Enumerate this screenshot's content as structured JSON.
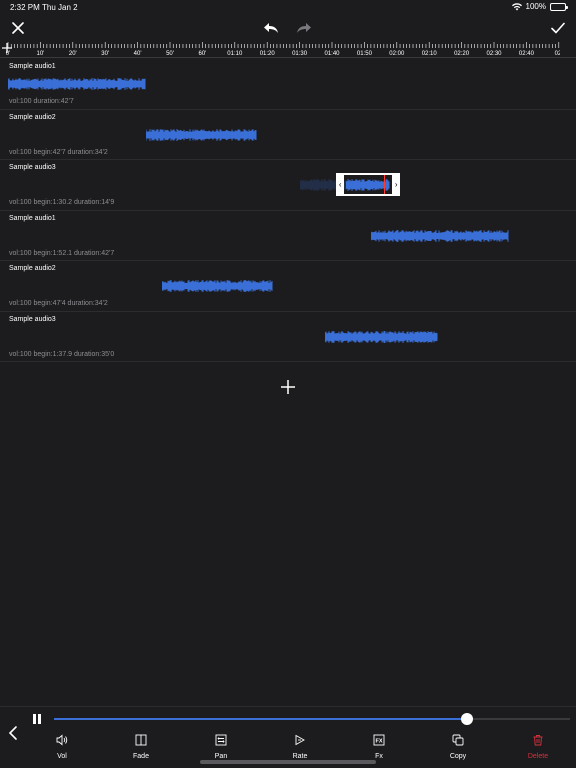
{
  "status": {
    "time": "2:32 PM",
    "date": "Thu Jan 2",
    "battery": "100%"
  },
  "ruler": {
    "labels": [
      "0'",
      "10'",
      "20'",
      "30'",
      "40'",
      "50'",
      "60'",
      "01:10",
      "01:20",
      "01:30",
      "01:40",
      "01:50",
      "02:00",
      "02:10",
      "02:20",
      "02:30",
      "02:40",
      "02:"
    ]
  },
  "tracks": [
    {
      "name": "Sample audio1",
      "info": "vol:100 duration:42'7",
      "start": 0,
      "duration": 42.7
    },
    {
      "name": "Sample audio2",
      "info": "vol:100 begin:42'7 duration:34'2",
      "start": 42.7,
      "duration": 34.2
    },
    {
      "name": "Sample audio3",
      "info": "vol:100 begin:1:30.2 duration:14'9",
      "start": 90.2,
      "duration": 14.9,
      "selected": true
    },
    {
      "name": "Sample audio1",
      "info": "vol:100 begin:1:52.1 duration:42'7",
      "start": 112.1,
      "duration": 42.7
    },
    {
      "name": "Sample audio2",
      "info": "vol:100 begin:47'4 duration:34'2",
      "start": 47.4,
      "duration": 34.2
    },
    {
      "name": "Sample audio3",
      "info": "vol:100 begin:1:37.9 duration:35'0",
      "start": 97.9,
      "duration": 35.0
    }
  ],
  "player": {
    "progress": 0.8
  },
  "tools": [
    {
      "label": "Vol",
      "icon": "speaker-icon"
    },
    {
      "label": "Fade",
      "icon": "fade-icon"
    },
    {
      "label": "Pan",
      "icon": "pan-icon"
    },
    {
      "label": "Rate",
      "icon": "rate-icon"
    },
    {
      "label": "Fx",
      "icon": "fx-icon"
    },
    {
      "label": "Copy",
      "icon": "copy-icon"
    },
    {
      "label": "Delete",
      "icon": "trash-icon"
    }
  ],
  "colors": {
    "wave": "#3a6fd8",
    "delete": "#d9303c",
    "cursor": "#ff3b30"
  }
}
